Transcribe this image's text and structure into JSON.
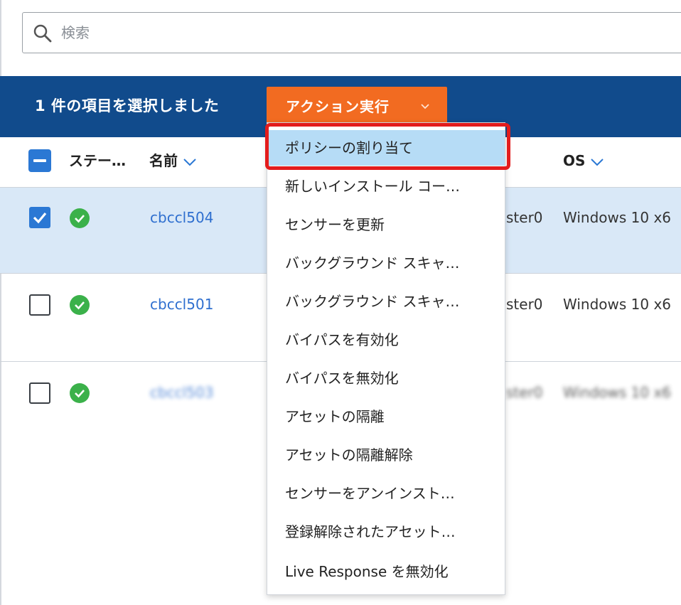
{
  "search": {
    "placeholder": "検索"
  },
  "selection_bar": {
    "text": "1 件の項目を選択しました",
    "action_button": "アクション実行"
  },
  "table": {
    "headers": {
      "status": "ステー…",
      "name": "名前",
      "os": "OS"
    },
    "rows": [
      {
        "selected": true,
        "name": "cbccl504",
        "group": "ster0",
        "os": "Windows 10 x6"
      },
      {
        "selected": false,
        "name": "cbccl501",
        "group": "ster0",
        "os": "Windows 10 x6"
      },
      {
        "selected": false,
        "name": "cbccl503",
        "group": "ster0",
        "os": "Windows 10 x6"
      }
    ]
  },
  "action_menu": {
    "items": [
      "ポリシーの割り当て",
      "新しいインストール コー…",
      "センサーを更新",
      "バックグラウンド スキャ…",
      "バックグラウンド スキャ…",
      "バイパスを有効化",
      "バイパスを無効化",
      "アセットの隔離",
      "アセットの隔離解除",
      "センサーをアンインスト…",
      "登録解除されたアセット…",
      "Live Response を無効化"
    ],
    "highlighted_item": "ポリシーの割り当て"
  },
  "colors": {
    "selection_bar": "#114b8c",
    "action_button": "#f26b21",
    "highlight_border": "#e31c1c",
    "active_item": "#b6dcf6",
    "status_ok": "#3bb14a",
    "link": "#2f6fcf"
  }
}
